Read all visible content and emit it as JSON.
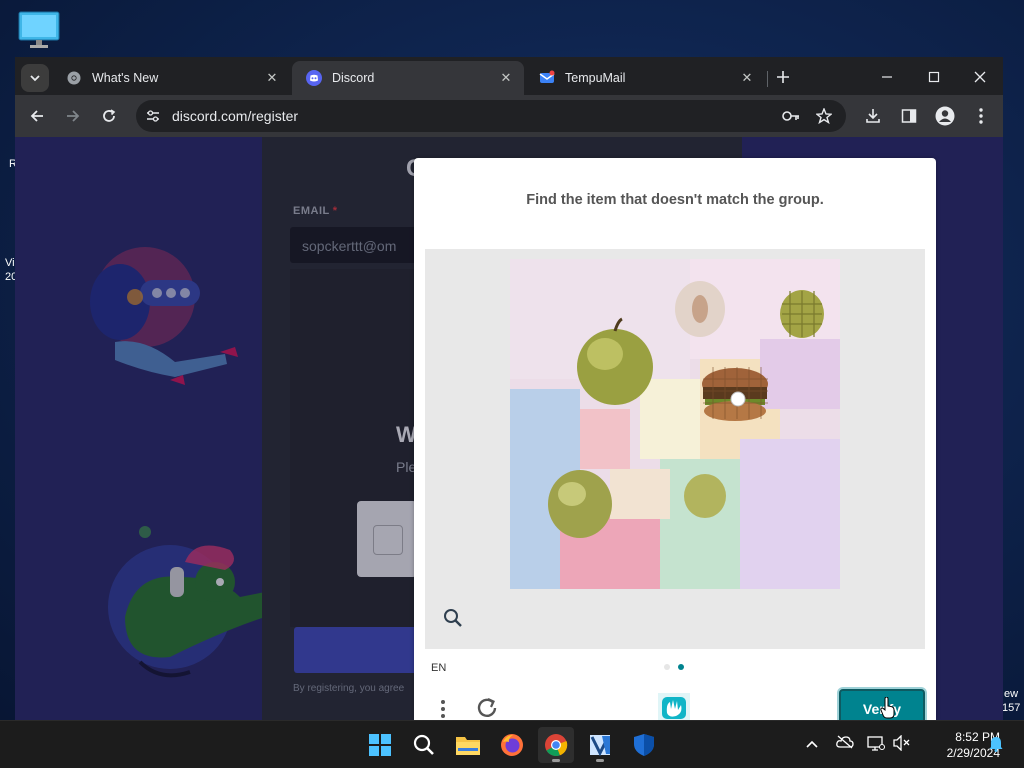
{
  "desktop": {
    "left_snippets": [
      "R",
      "Vi",
      "20"
    ],
    "right_snippets": [
      "ew",
      "157"
    ]
  },
  "browser": {
    "tabs": [
      {
        "label": "What's New",
        "icon": "chrome-icon",
        "active": false
      },
      {
        "label": "Discord",
        "icon": "discord-icon",
        "active": true
      },
      {
        "label": "TempuMail",
        "icon": "mail-icon",
        "active": false
      }
    ],
    "url": "discord.com/register"
  },
  "register": {
    "email_label": "EMAIL",
    "required_mark": "*",
    "email_value": "sopckerttt@om",
    "heading_initial": "C",
    "modal_title": "W",
    "modal_subtitle": "Ple",
    "terms_text": "By registering, you agree"
  },
  "captcha": {
    "prompt": "Find the item that doesn't match the group.",
    "language": "EN",
    "verify_label": "Verify",
    "accent": "#00838f"
  },
  "taskbar": {
    "apps": [
      "windows-start-icon",
      "search-icon",
      "file-explorer-icon",
      "firefox-icon",
      "chrome-icon",
      "visual-studio-icon",
      "defender-icon"
    ],
    "time": "8:52 PM",
    "date": "2/29/2024"
  }
}
